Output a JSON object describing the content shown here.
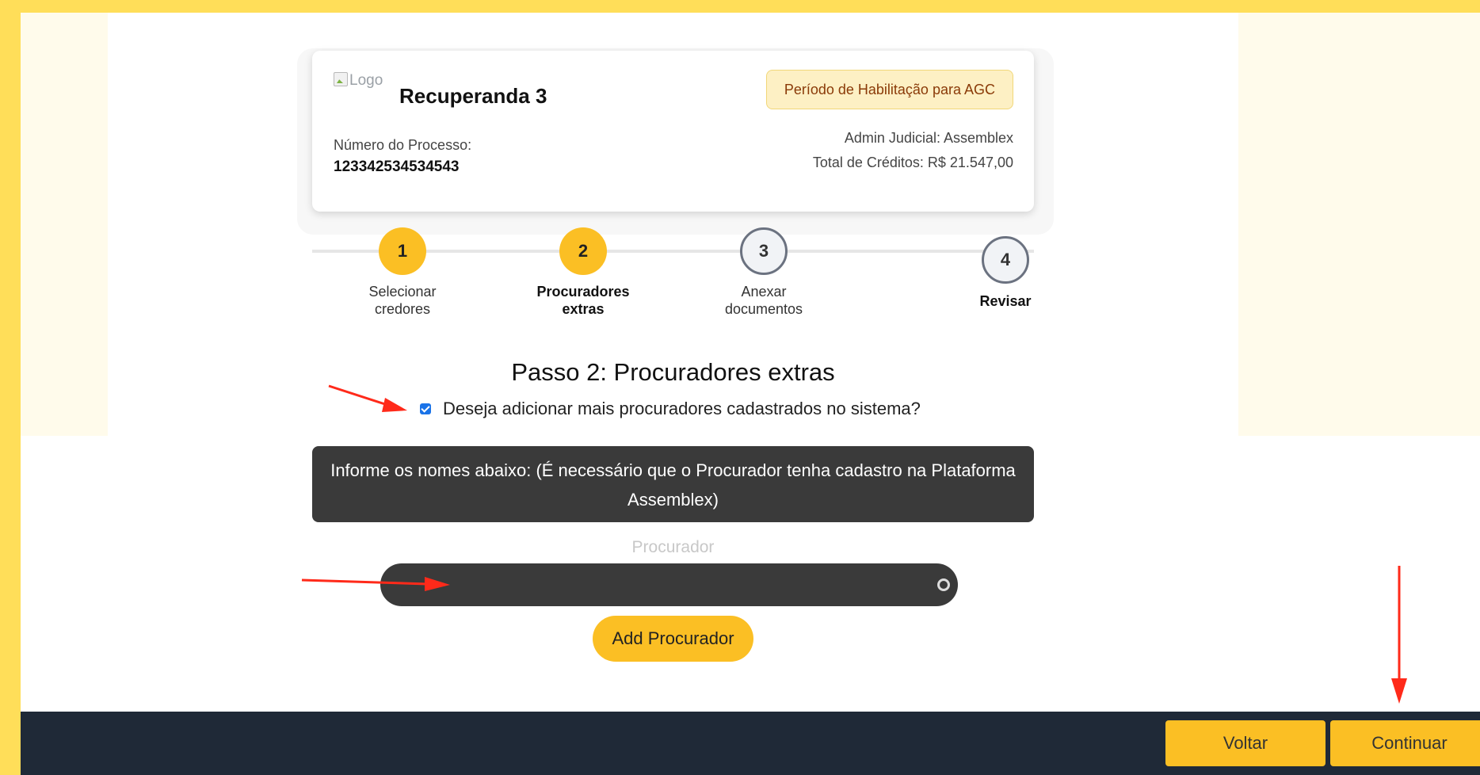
{
  "header": {
    "logo_alt": "Logo",
    "company_name": "Recuperanda 3",
    "process_label": "Número do Processo:",
    "process_number": "123342534534543",
    "period_badge": "Período de Habilitação para AGC",
    "admin": "Admin Judicial: Assemblex",
    "total_credits": "Total de Créditos: R$ 21.547,00"
  },
  "stepper": {
    "steps": [
      {
        "number": "1",
        "label_line1": "Selecionar",
        "label_line2": "credores",
        "state": "done"
      },
      {
        "number": "2",
        "label_line1": "Procuradores",
        "label_line2": "extras",
        "state": "current"
      },
      {
        "number": "3",
        "label_line1": "Anexar",
        "label_line2": "documentos",
        "state": "todo"
      },
      {
        "number": "4",
        "label_line1": "Revisar",
        "label_line2": "",
        "state": "todo"
      }
    ]
  },
  "main": {
    "title": "Passo 2: Procuradores extras",
    "checkbox_label": "Deseja adicionar mais procuradores cadastrados no sistema?",
    "checkbox_checked": true,
    "info_line1": "Informe os nomes abaixo: (É necessário que o Procurador tenha cadastro na Plataforma",
    "info_line2": "Assemblex)",
    "field_label": "Procurador",
    "add_button": "Add Procurador"
  },
  "footer": {
    "back_button": "Voltar",
    "continue_button": "Continuar"
  },
  "colors": {
    "frame": "#ffde59",
    "accent": "#fbbf24",
    "footer_bg": "#1f2937",
    "dark_box": "#3a3a3a",
    "annotation_arrow": "#ff2a1a"
  },
  "icons": {
    "clear_select": "clear-circle-icon",
    "checkbox": "checkmark-icon",
    "annotation": "red-arrow-icon"
  }
}
